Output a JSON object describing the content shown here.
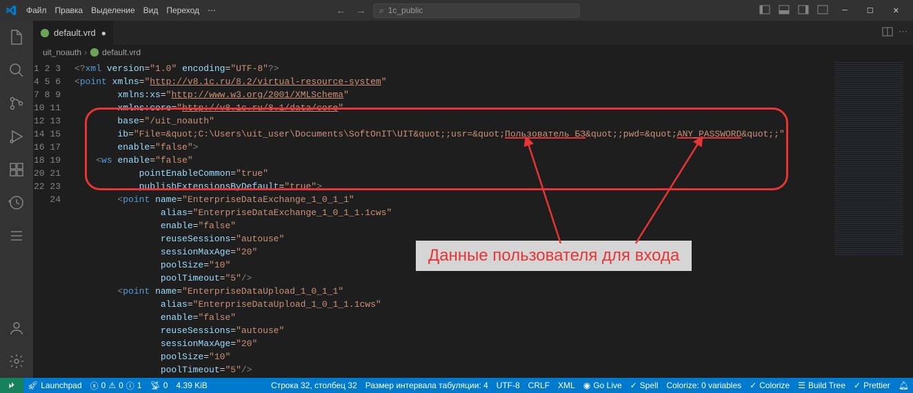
{
  "titlebar": {
    "menus": [
      "Файл",
      "Правка",
      "Выделение",
      "Вид",
      "Переход"
    ],
    "ellipsis": "⋯",
    "search_placeholder": "1c_public"
  },
  "tab": {
    "filename": "default.vrd",
    "modified": true
  },
  "breadcrumb": {
    "parent": "uit_noauth",
    "file": "default.vrd"
  },
  "annotation": {
    "label": "Данные пользователя для входа"
  },
  "code": {
    "lines": [
      1,
      2,
      3,
      4,
      5,
      6,
      7,
      8,
      9,
      10,
      11,
      12,
      13,
      14,
      15,
      16,
      17,
      18,
      19,
      20,
      21,
      22,
      23,
      24
    ]
  },
  "xml": {
    "version": "1.0",
    "encoding": "UTF-8",
    "xmlns": "http://v8.1c.ru/8.2/virtual-resource-system",
    "xmlns_xs": "http://www.w3.org/2001/XMLSchema",
    "xmlns_core": "http://v8.1c.ru/8.1/data/core",
    "base": "/uit_noauth",
    "ib_prefix": "File=&quot;C:\\Users\\uit_user\\Documents\\SoftOnIT\\UIT&quot;;usr=&quot;",
    "ib_user": "Пользователь БЗ",
    "ib_mid": "&quot;;pwd=&quot;",
    "ib_pwd": "ANY_PASSWORD",
    "ib_suffix": "&quot;;",
    "enable": "false",
    "ws_enable": "false",
    "pointEnableCommon": "true",
    "publishExtensionsByDefault": "true",
    "points": [
      {
        "name": "EnterpriseDataExchange_1_0_1_1",
        "alias": "EnterpriseDataExchange_1_0_1_1.1cws",
        "enable": "false",
        "reuseSessions": "autouse",
        "sessionMaxAge": "20",
        "poolSize": "10",
        "poolTimeout": "5"
      },
      {
        "name": "EnterpriseDataUpload_1_0_1_1",
        "alias": "EnterpriseDataUpload_1_0_1_1.1cws",
        "enable": "false",
        "reuseSessions": "autouse",
        "sessionMaxAge": "20",
        "poolSize": "10",
        "poolTimeout": "5"
      }
    ]
  },
  "status": {
    "launchpad": "Launchpad",
    "errors": "0",
    "warnings": "0",
    "info": "1",
    "radio": "0",
    "size": "4.39 KiB",
    "cursor": "Строка 32, столбец 32",
    "tabsize": "Размер интервала табуляции: 4",
    "encoding": "UTF-8",
    "eol": "CRLF",
    "lang": "XML",
    "golive": "Go Live",
    "spell": "Spell",
    "colorize": "Colorize: 0 variables",
    "colorize2": "Colorize",
    "buildtree": "Build Tree",
    "prettier": "Prettier",
    "bell": ""
  }
}
